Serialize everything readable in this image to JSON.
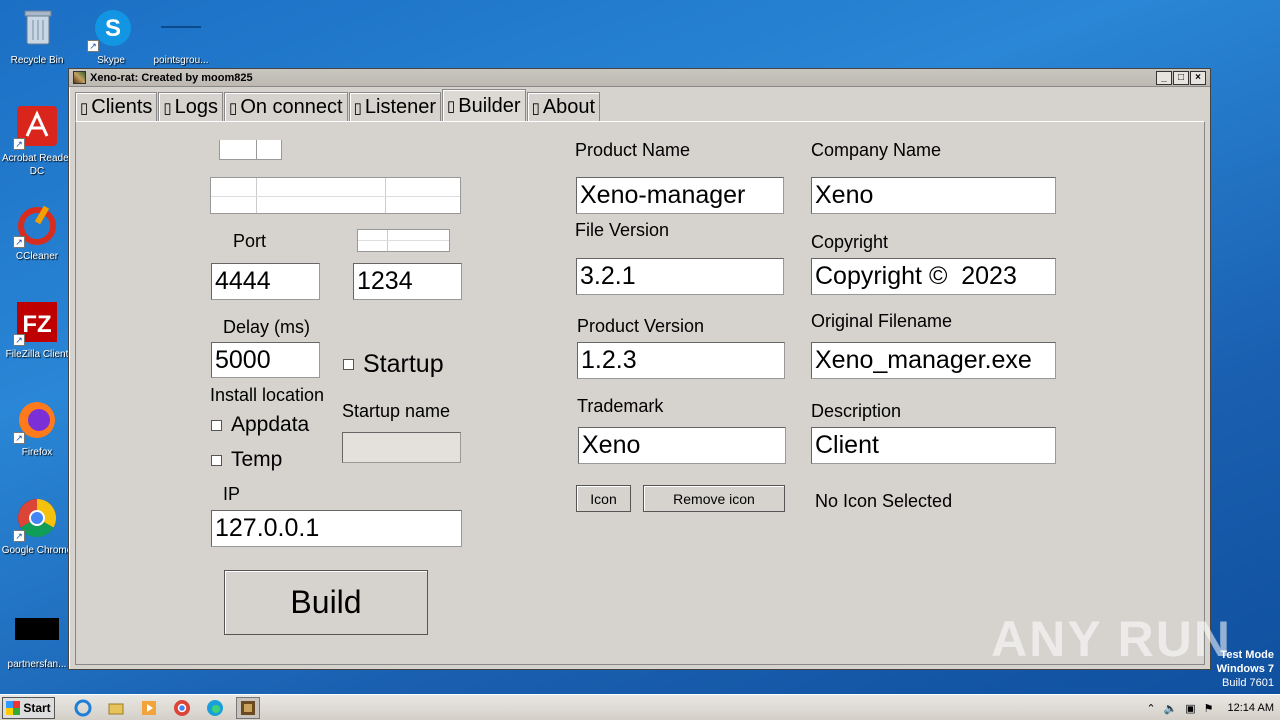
{
  "desktop": {
    "icons": [
      {
        "label": "Recycle Bin",
        "icon": "recycle-bin-icon"
      },
      {
        "label": "Skype",
        "icon": "skype-icon"
      },
      {
        "label": "pointsgrou...",
        "icon": "file-icon"
      },
      {
        "label": "Acrobat Reader DC",
        "icon": "acrobat-icon"
      },
      {
        "label": "CCleaner",
        "icon": "ccleaner-icon"
      },
      {
        "label": "FileZilla Client",
        "icon": "filezilla-icon"
      },
      {
        "label": "Firefox",
        "icon": "firefox-icon"
      },
      {
        "label": "Google Chrome",
        "icon": "chrome-icon"
      },
      {
        "label": "partnersfan...",
        "icon": "file-icon"
      }
    ]
  },
  "window": {
    "title": "Xeno-rat: Created by moom825",
    "controls": {
      "minimize": "_",
      "maximize": "□",
      "close": "×"
    },
    "tabs": [
      {
        "label": "Clients",
        "glyph": "▯"
      },
      {
        "label": "Logs",
        "glyph": "▯"
      },
      {
        "label": "On connect",
        "glyph": "▯"
      },
      {
        "label": "Listener",
        "glyph": "▯"
      },
      {
        "label": "Builder",
        "glyph": "▯",
        "active": true
      },
      {
        "label": "About",
        "glyph": "▯"
      }
    ]
  },
  "builder": {
    "port_label": "Port",
    "port_value": "4444",
    "second_port_value": "1234",
    "delay_label": "Delay (ms)",
    "delay_value": "5000",
    "startup_label": "Startup",
    "install_location_label": "Install location",
    "appdata_label": "Appdata",
    "temp_label": "Temp",
    "startup_name_label": "Startup name",
    "startup_name_value": "",
    "ip_label": "IP",
    "ip_value": "127.0.0.1",
    "build_button": "Build",
    "product_name_label": "Product Name",
    "product_name_value": "Xeno-manager",
    "company_name_label": "Company Name",
    "company_name_value": "Xeno",
    "file_version_label": "File Version",
    "file_version_value": "3.2.1",
    "copyright_label": "Copyright",
    "copyright_value": "Copyright ©  2023",
    "product_version_label": "Product Version",
    "product_version_value": "1.2.3",
    "original_filename_label": "Original Filename",
    "original_filename_value": "Xeno_manager.exe",
    "trademark_label": "Trademark",
    "trademark_value": "Xeno",
    "description_label": "Description",
    "description_value": "Client",
    "icon_button": "Icon",
    "remove_icon_button": "Remove icon",
    "icon_status": "No Icon Selected"
  },
  "taskbar": {
    "start_label": "Start",
    "time": "12:14 AM"
  },
  "watermark": "ANY RUN",
  "test_mode": {
    "line1": "Test Mode",
    "line2": "Windows 7",
    "line3": "Build 7601"
  }
}
